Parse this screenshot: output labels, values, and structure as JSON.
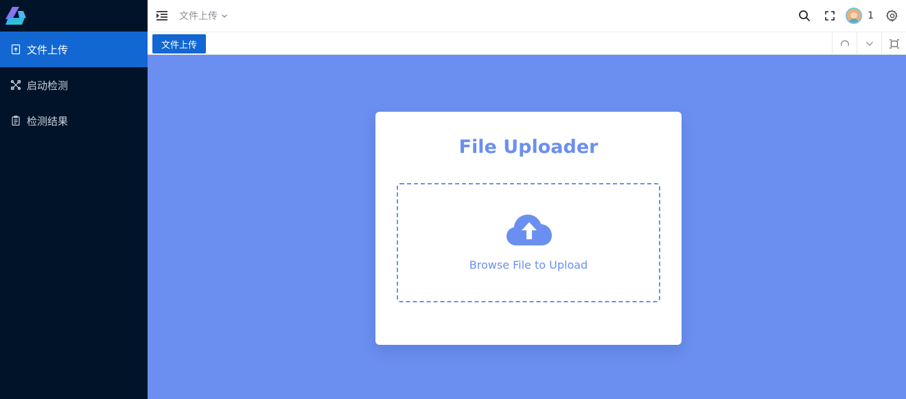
{
  "sidebar": {
    "items": [
      {
        "label": "文件上传",
        "icon": "file-upload-icon",
        "active": true
      },
      {
        "label": "启动检测",
        "icon": "tools-icon",
        "active": false
      },
      {
        "label": "检测结果",
        "icon": "clipboard-icon",
        "active": false
      }
    ]
  },
  "header": {
    "breadcrumb": "文件上传",
    "user_name": "1"
  },
  "tabs": [
    {
      "label": "文件上传",
      "active": true
    }
  ],
  "uploader": {
    "title": "File Uploader",
    "browse_text": "Browse File to Upload"
  },
  "colors": {
    "sidebar_bg": "#011328",
    "accent": "#1267d3",
    "content_bg": "#6b8ff0"
  }
}
